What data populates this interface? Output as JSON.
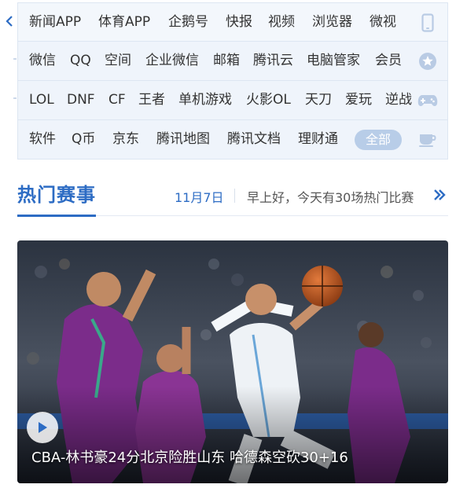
{
  "nav": {
    "rows": [
      {
        "items": [
          "新闻APP",
          "体育APP",
          "企鹅号",
          "快报",
          "视频",
          "浏览器",
          "微视"
        ],
        "icon": "phone-icon"
      },
      {
        "items": [
          "微信",
          "QQ",
          "空间",
          "企业微信",
          "邮箱",
          "腾讯云",
          "电脑管家",
          "会员"
        ],
        "icon": "star-icon"
      },
      {
        "items": [
          "LOL",
          "DNF",
          "CF",
          "王者",
          "单机游戏",
          "火影OL",
          "天刀",
          "爱玩",
          "逆战"
        ],
        "icon": "gamepad-icon"
      },
      {
        "items": [
          "软件",
          "Q币",
          "京东",
          "腾讯地图",
          "腾讯文档",
          "理财通"
        ],
        "pill": "全部",
        "icon": "cup-icon"
      }
    ]
  },
  "section": {
    "title": "热门赛事",
    "date": "11月7日",
    "greeting": "早上好，今天有30场热门比赛",
    "more_icon": "double-chevron-right-icon"
  },
  "hero": {
    "caption": "CBA-林书豪24分北京险胜山东 哈德森空砍30+16",
    "play_icon": "play-icon"
  },
  "colors": {
    "accent": "#2d6cc4",
    "nav_bg": "#eff4fb",
    "pill_bg": "#b8cde8",
    "icon": "#b9cbe4"
  }
}
